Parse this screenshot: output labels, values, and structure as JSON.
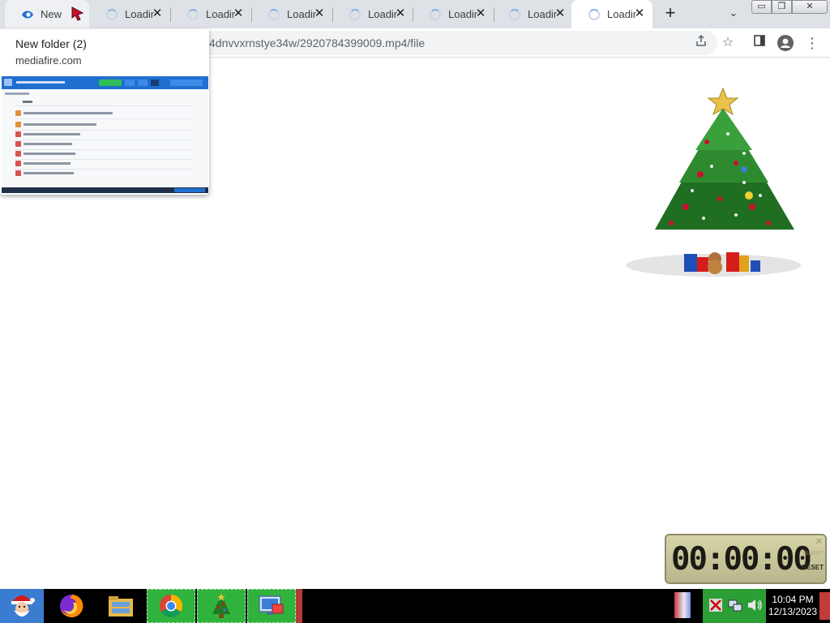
{
  "tabs": [
    {
      "title": "New folder",
      "state": "page"
    },
    {
      "title": "Loading",
      "state": "loading"
    },
    {
      "title": "Loading",
      "state": "loading"
    },
    {
      "title": "Loading",
      "state": "loading"
    },
    {
      "title": "Loading",
      "state": "loading"
    },
    {
      "title": "Loading",
      "state": "loading"
    },
    {
      "title": "Loading",
      "state": "loading"
    },
    {
      "title": "Loading",
      "state": "loading"
    }
  ],
  "tab_close_glyph": "✕",
  "new_tab_glyph": "+",
  "tab_search_glyph": "⌄",
  "window_buttons": {
    "minimize": "▭",
    "restore": "❐",
    "close": "✕"
  },
  "address_bar": {
    "url": "4dnvvxrnstye34w/2920784399009.mp4/file"
  },
  "toolbar_icons": [
    "share-icon",
    "bookmark-star-icon",
    "side-panel-icon",
    "profile-icon",
    "menu-icon"
  ],
  "hover_card": {
    "title": "New folder (2)",
    "domain": "mediafire.com"
  },
  "stopwatch": {
    "display": "00:00:00",
    "submit_label": "SUBMIT",
    "reset_label": "RESET",
    "close_glyph": "✕"
  },
  "taskbar": {
    "apps": [
      "santa-start-icon",
      "firefox-icon",
      "file-manager-icon",
      "chrome-icon",
      "christmas-tree-icon",
      "remote-desktop-icon"
    ],
    "clock_time": "10:04 PM",
    "clock_date": "12/13/2023"
  },
  "colors": {
    "tabstrip": "#dee1e6",
    "taskbar": "#000000",
    "taskbar_green": "#30b33c",
    "mediafire_blue": "#1f6fd1"
  }
}
